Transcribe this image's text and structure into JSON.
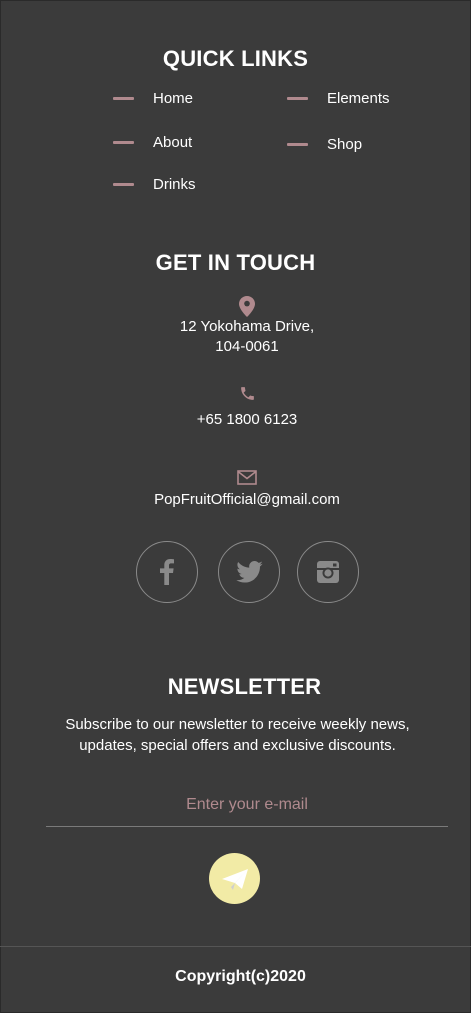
{
  "quick_links": {
    "title": "QUICK LINKS",
    "left": [
      "Home",
      "About",
      "Drinks"
    ],
    "right": [
      "Elements",
      "Shop"
    ]
  },
  "get_in_touch": {
    "title": "GET IN TOUCH",
    "address_line1": "12 Yokohama Drive,",
    "address_line2": "104-0061",
    "phone": "+65 1800 6123",
    "email": "PopFruitOfficial@gmail.com",
    "icons": [
      "location-pin-icon",
      "phone-icon",
      "mail-icon"
    ]
  },
  "social": [
    "facebook-icon",
    "twitter-icon",
    "instagram-icon"
  ],
  "newsletter": {
    "title": "NEWSLETTER",
    "desc_line1": "Subscribe to our newsletter to receive weekly news,",
    "desc_line2": "updates, special offers and exclusive discounts.",
    "placeholder": "Enter your e-mail",
    "send_icon": "paper-plane-icon"
  },
  "footer": {
    "copyright": "Copyright(c)2020"
  },
  "colors": {
    "background": "#3b3b3b",
    "accent": "#b08a8e",
    "send_button": "#f2eba6"
  }
}
